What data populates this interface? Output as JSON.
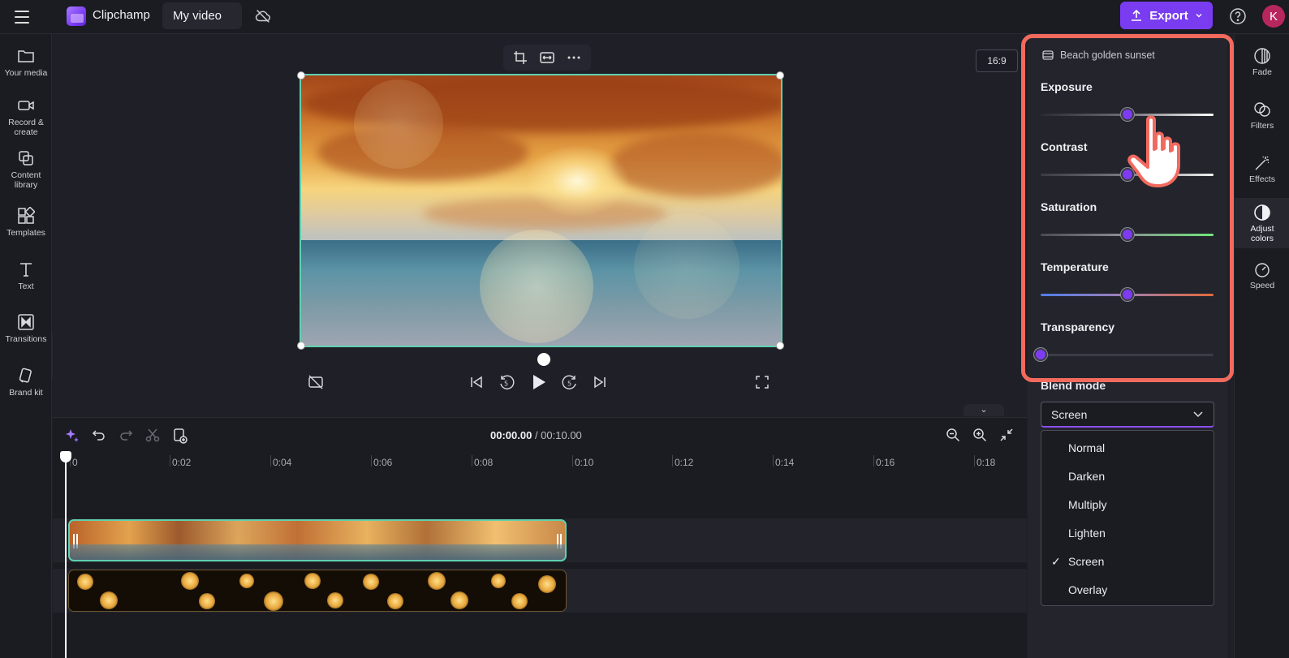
{
  "header": {
    "app_name": "Clipchamp",
    "project_title": "My video",
    "export_label": "Export",
    "avatar_initial": "K"
  },
  "left_sidebar": {
    "items": [
      {
        "label": "Your media",
        "icon": "folder-icon"
      },
      {
        "label": "Record &\ncreate",
        "icon": "camera-icon"
      },
      {
        "label": "Content\nlibrary",
        "icon": "library-icon"
      },
      {
        "label": "Templates",
        "icon": "templates-icon"
      },
      {
        "label": "Text",
        "icon": "text-icon"
      },
      {
        "label": "Transitions",
        "icon": "transitions-icon"
      },
      {
        "label": "Brand kit",
        "icon": "brand-kit-icon"
      }
    ]
  },
  "preview": {
    "aspect_ratio": "16:9",
    "toolbar_icons": [
      "crop-icon",
      "fit-icon",
      "more-icon"
    ],
    "controls": [
      "hide-captions-icon",
      "skip-back-icon",
      "rewind-5-icon",
      "play-icon",
      "forward-5-icon",
      "skip-forward-icon",
      "fullscreen-icon"
    ]
  },
  "timeline": {
    "current_time": "00:00.00",
    "total_time": "/ 00:10.00",
    "ticks": [
      "0",
      "0:02",
      "0:04",
      "0:06",
      "0:08",
      "0:10",
      "0:12",
      "0:14",
      "0:16",
      "0:18"
    ]
  },
  "right_panel": {
    "clip_name": "Beach golden sunset",
    "sliders": [
      {
        "label": "Exposure",
        "value": 0.5,
        "track": "exposure"
      },
      {
        "label": "Contrast",
        "value": 0.5,
        "track": "contrast"
      },
      {
        "label": "Saturation",
        "value": 0.5,
        "track": "saturation"
      },
      {
        "label": "Temperature",
        "value": 0.5,
        "track": "temperature"
      },
      {
        "label": "Transparency",
        "value": 0.0,
        "track": "transparency"
      }
    ],
    "blend_mode_label": "Blend mode",
    "blend_mode_selected": "Screen",
    "blend_options": [
      "Normal",
      "Darken",
      "Multiply",
      "Lighten",
      "Screen",
      "Overlay"
    ]
  },
  "right_rail": {
    "items": [
      {
        "label": "Fade",
        "icon": "fade-icon"
      },
      {
        "label": "Filters",
        "icon": "filters-icon"
      },
      {
        "label": "Effects",
        "icon": "effects-icon"
      },
      {
        "label": "Adjust\ncolors",
        "icon": "adjust-colors-icon",
        "active": true
      },
      {
        "label": "Speed",
        "icon": "speed-icon"
      }
    ]
  },
  "colors": {
    "accent": "#7a3cf0",
    "highlight": "#f26a5e",
    "selection": "#5fd1b0"
  }
}
